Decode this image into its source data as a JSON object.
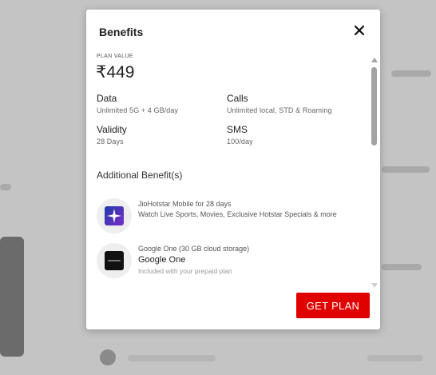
{
  "modal": {
    "title": "Benefits",
    "close_icon": "close-icon",
    "plan_value_label": "PLAN VALUE",
    "price": "₹449",
    "specs": [
      {
        "title": "Data",
        "value": "Unlimited 5G + 4 GB/day"
      },
      {
        "title": "Calls",
        "value": "Unlimited local, STD & Roaming"
      },
      {
        "title": "Validity",
        "value": "28 Days"
      },
      {
        "title": "SMS",
        "value": "100/day"
      }
    ],
    "additional_title": "Additional Benefit(s)",
    "benefits": [
      {
        "icon": "jiohotstar-logo-icon",
        "line1": "JioHotstar Mobile for 28 days",
        "line2": "Watch Live Sports, Movies, Exclusive Hotstar Specials & more"
      },
      {
        "icon": "google-one-logo-icon",
        "line1": "Google One (30 GB cloud storage)",
        "name": "Google One",
        "line3": "Included with your prepaid plan"
      }
    ],
    "cta_label": "GET PLAN"
  },
  "colors": {
    "accent": "#e00000",
    "overlay": "#bdbdbd"
  }
}
